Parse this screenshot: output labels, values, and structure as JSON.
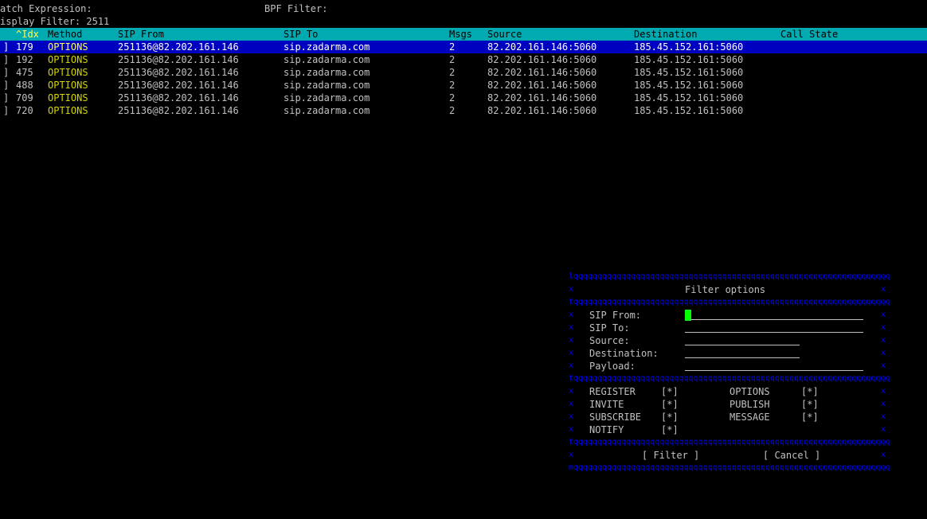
{
  "top": {
    "match_expression_label": "atch Expression:",
    "bpf_filter_label": "BPF Filter:",
    "display_filter_label": "isplay Filter: 2511"
  },
  "columns": {
    "idx": "^Idx",
    "method": "Method",
    "sip_from": "SIP From",
    "sip_to": "SIP To",
    "msgs": "Msgs",
    "source": "Source",
    "destination": "Destination",
    "call_state": "Call State"
  },
  "rows": [
    {
      "mark": "]",
      "idx": "179",
      "method": "OPTIONS",
      "sip_from": "251136@82.202.161.146",
      "sip_to": "sip.zadarma.com",
      "msgs": "2",
      "source": "82.202.161.146:5060",
      "destination": "185.45.152.161:5060",
      "call_state": ""
    },
    {
      "mark": "]",
      "idx": "192",
      "method": "OPTIONS",
      "sip_from": "251136@82.202.161.146",
      "sip_to": "sip.zadarma.com",
      "msgs": "2",
      "source": "82.202.161.146:5060",
      "destination": "185.45.152.161:5060",
      "call_state": ""
    },
    {
      "mark": "]",
      "idx": "475",
      "method": "OPTIONS",
      "sip_from": "251136@82.202.161.146",
      "sip_to": "sip.zadarma.com",
      "msgs": "2",
      "source": "82.202.161.146:5060",
      "destination": "185.45.152.161:5060",
      "call_state": ""
    },
    {
      "mark": "]",
      "idx": "488",
      "method": "OPTIONS",
      "sip_from": "251136@82.202.161.146",
      "sip_to": "sip.zadarma.com",
      "msgs": "2",
      "source": "82.202.161.146:5060",
      "destination": "185.45.152.161:5060",
      "call_state": ""
    },
    {
      "mark": "]",
      "idx": "709",
      "method": "OPTIONS",
      "sip_from": "251136@82.202.161.146",
      "sip_to": "sip.zadarma.com",
      "msgs": "2",
      "source": "82.202.161.146:5060",
      "destination": "185.45.152.161:5060",
      "call_state": ""
    },
    {
      "mark": "]",
      "idx": "720",
      "method": "OPTIONS",
      "sip_from": "251136@82.202.161.146",
      "sip_to": "sip.zadarma.com",
      "msgs": "2",
      "source": "82.202.161.146:5060",
      "destination": "185.45.152.161:5060",
      "call_state": ""
    }
  ],
  "dialog": {
    "title": "Filter options",
    "fields": {
      "sip_from": {
        "label": "SIP From:",
        "value": ""
      },
      "sip_to": {
        "label": "SIP To:",
        "value": ""
      },
      "source": {
        "label": "Source:",
        "value": ""
      },
      "destination": {
        "label": "Destination:",
        "value": ""
      },
      "payload": {
        "label": "Payload:",
        "value": ""
      }
    },
    "methods": {
      "register": {
        "label": "REGISTER",
        "state": "[*]"
      },
      "invite": {
        "label": "INVITE",
        "state": "[*]"
      },
      "subscribe": {
        "label": "SUBSCRIBE",
        "state": "[*]"
      },
      "notify": {
        "label": "NOTIFY",
        "state": "[*]"
      },
      "options": {
        "label": "OPTIONS",
        "state": "[*]"
      },
      "publish": {
        "label": "PUBLISH",
        "state": "[*]"
      },
      "message": {
        "label": "MESSAGE",
        "state": "[*]"
      }
    },
    "filter_button": "[ Filter ]",
    "cancel_button": "[ Cancel ]"
  },
  "colors": {
    "header_bg": "#00aab0",
    "selected_row_bg": "#0000c0",
    "method_text": "#d4d400",
    "dialog_border": "#0000ff",
    "cursor": "#00ff00"
  }
}
